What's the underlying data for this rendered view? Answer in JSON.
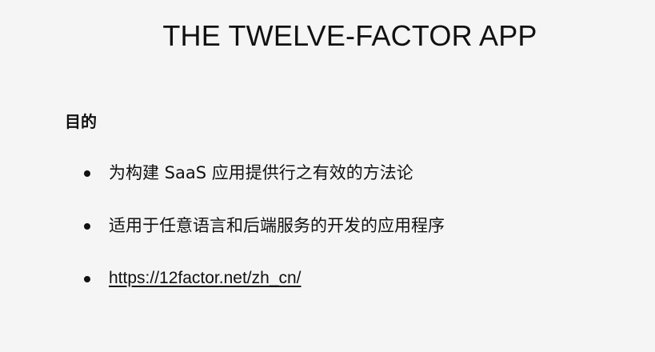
{
  "slide": {
    "title": "THE TWELVE-FACTOR APP",
    "section_heading": "目的",
    "bullets": [
      {
        "text": "为构建 SaaS 应用提供行之有效的方法论"
      },
      {
        "text": "适用于任意语言和后端服务的开发的应用程序"
      },
      {
        "link_text": "https://12factor.net/zh_cn/"
      }
    ]
  }
}
